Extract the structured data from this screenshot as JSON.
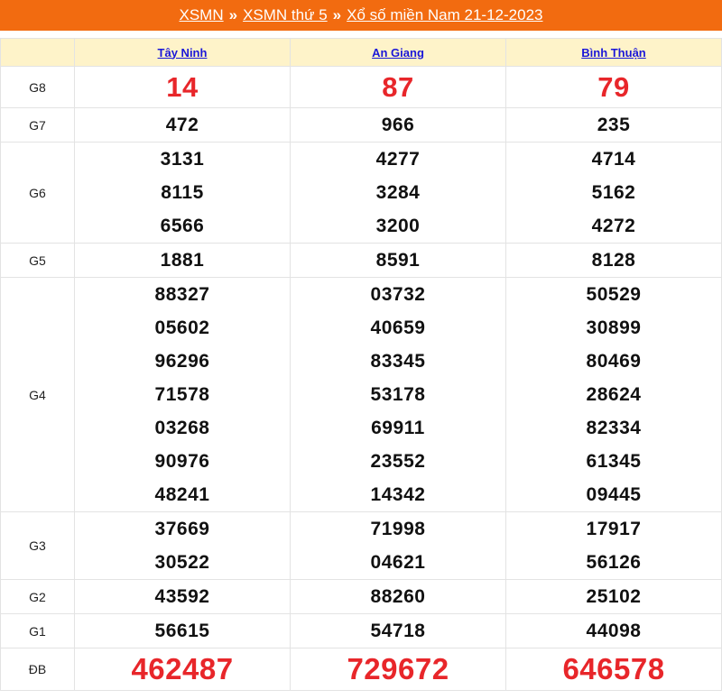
{
  "breadcrumb": {
    "items": [
      "XSMN",
      "XSMN thứ 5",
      "Xổ số miền Nam 21-12-2023"
    ],
    "separator": "»"
  },
  "provinces": [
    "Tây Ninh",
    "An Giang",
    "Bình Thuận"
  ],
  "prizes": [
    {
      "label": "G8",
      "values": [
        [
          "14"
        ],
        [
          "87"
        ],
        [
          "79"
        ]
      ]
    },
    {
      "label": "G7",
      "values": [
        [
          "472"
        ],
        [
          "966"
        ],
        [
          "235"
        ]
      ]
    },
    {
      "label": "G6",
      "values": [
        [
          "3131",
          "8115",
          "6566"
        ],
        [
          "4277",
          "3284",
          "3200"
        ],
        [
          "4714",
          "5162",
          "4272"
        ]
      ]
    },
    {
      "label": "G5",
      "values": [
        [
          "1881"
        ],
        [
          "8591"
        ],
        [
          "8128"
        ]
      ]
    },
    {
      "label": "G4",
      "values": [
        [
          "88327",
          "05602",
          "96296",
          "71578",
          "03268",
          "90976",
          "48241"
        ],
        [
          "03732",
          "40659",
          "83345",
          "53178",
          "69911",
          "23552",
          "14342"
        ],
        [
          "50529",
          "30899",
          "80469",
          "28624",
          "82334",
          "61345",
          "09445"
        ]
      ]
    },
    {
      "label": "G3",
      "values": [
        [
          "37669",
          "30522"
        ],
        [
          "71998",
          "04621"
        ],
        [
          "17917",
          "56126"
        ]
      ]
    },
    {
      "label": "G2",
      "values": [
        [
          "43592"
        ],
        [
          "88260"
        ],
        [
          "25102"
        ]
      ]
    },
    {
      "label": "G1",
      "values": [
        [
          "56615"
        ],
        [
          "54718"
        ],
        [
          "44098"
        ]
      ]
    },
    {
      "label": "ĐB",
      "values": [
        [
          "462487"
        ],
        [
          "729672"
        ],
        [
          "646578"
        ]
      ]
    }
  ],
  "colors": {
    "header_bar": "#f26b10",
    "special_number": "#e8262a",
    "province_link": "#1a17d8",
    "header_row": "#fef3c9"
  }
}
